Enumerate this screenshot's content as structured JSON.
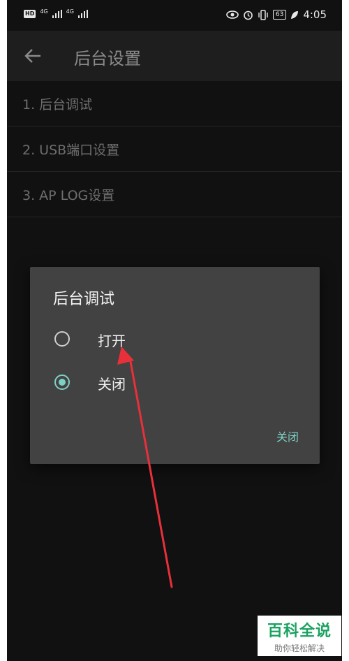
{
  "status_bar": {
    "hd": "HD",
    "signal_1": "4G",
    "signal_2": "4G",
    "battery": "63",
    "time": "4:05"
  },
  "app_bar": {
    "title": "后台设置"
  },
  "list": [
    {
      "label": "1. 后台调试"
    },
    {
      "label": "2. USB端口设置"
    },
    {
      "label": "3. AP LOG设置"
    }
  ],
  "dialog": {
    "title": "后台调试",
    "options": [
      {
        "label": "打开",
        "checked": false
      },
      {
        "label": "关闭",
        "checked": true
      }
    ],
    "action_label": "关闭",
    "accent_color": "#7fd0c4"
  },
  "watermark": {
    "main": "百科全说",
    "sub": "助你轻松解决"
  },
  "annotation_arrow_color": "#e8303a"
}
